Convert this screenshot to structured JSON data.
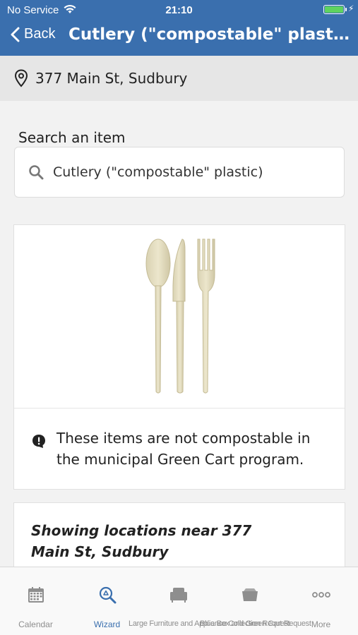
{
  "status_bar": {
    "carrier": "No Service",
    "time": "21:10"
  },
  "nav": {
    "back_label": "Back",
    "title": "Cutlery (\"compostable\" plastic)"
  },
  "address": {
    "text": "377 Main St, Sudbury",
    "icon": "location-pin-icon"
  },
  "search": {
    "label": "Search an item",
    "value": "Cutlery (\"compostable\" plastic)",
    "icon": "search-icon"
  },
  "item": {
    "image": "compostable-cutlery-image",
    "notice_icon": "alert-icon",
    "notice": "These items are not compostable in the municipal Green Cart program."
  },
  "locations": {
    "heading": "Showing locations near 377 Main St, Sudbury"
  },
  "tabs": [
    {
      "label": "Calendar",
      "icon": "calendar-icon",
      "active": false
    },
    {
      "label": "Wizard",
      "icon": "recycle-search-icon",
      "active": true
    },
    {
      "label": "Large Furniture and Appliance Collection Request",
      "icon": "armchair-icon",
      "active": false
    },
    {
      "label": "Blue Box and Green Cart Request",
      "icon": "bin-icon",
      "active": false
    },
    {
      "label": "More",
      "icon": "more-dots-icon",
      "active": false
    }
  ],
  "colors": {
    "primary": "#3a6fae",
    "tab_inactive": "#8e8e8e",
    "battery": "#5fd35f"
  }
}
